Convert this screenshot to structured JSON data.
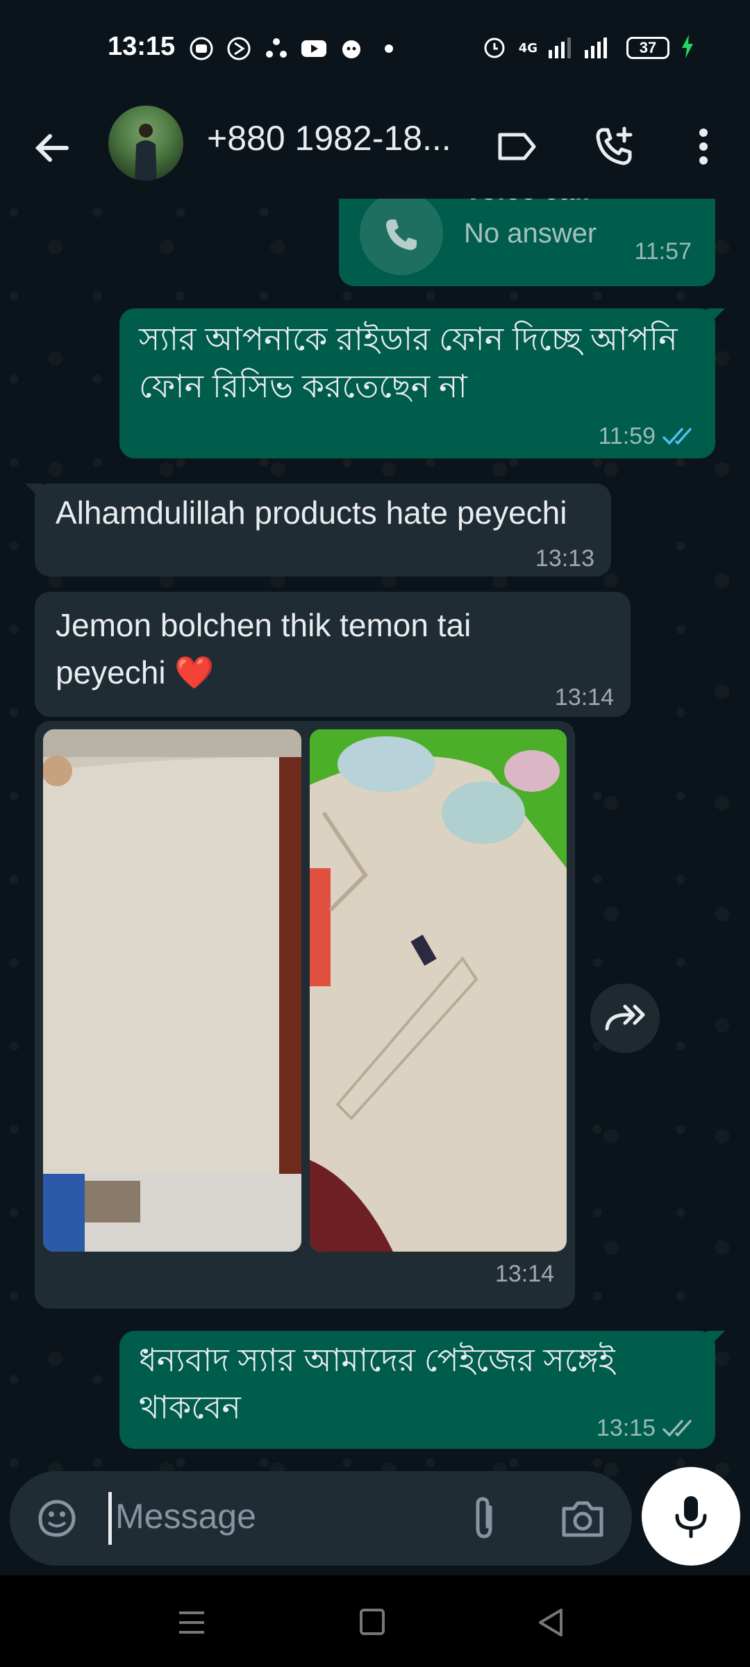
{
  "status_bar": {
    "time": "13:15",
    "network": "4G",
    "battery": "37",
    "icons": [
      "youtube-icon",
      "app-icon",
      "share-icon",
      "youtube-icon",
      "app-icon",
      "dot-icon",
      "alarm-icon",
      "signal-icon",
      "charging-icon"
    ]
  },
  "header": {
    "contact_name": "+880 1982-18...",
    "icons": [
      "back-arrow-icon",
      "label-icon",
      "add-call-icon",
      "more-vert-icon"
    ]
  },
  "messages": [
    {
      "direction": "outgoing",
      "type": "call",
      "call_title": "Voice call",
      "call_status": "No answer",
      "time": "11:57"
    },
    {
      "direction": "outgoing",
      "type": "text",
      "text": "স্যার আপনাকে রাইডার ফোন দিচ্ছে আপনি ফোন রিসিভ করতেছেন না",
      "time": "11:59",
      "read": true
    },
    {
      "direction": "incoming",
      "type": "text",
      "text": "Alhamdulillah products hate peyechi",
      "time": "13:13"
    },
    {
      "direction": "incoming",
      "type": "text",
      "text": "Jemon bolchen thik temon tai peyechi ❤️",
      "time": "13:14"
    },
    {
      "direction": "incoming",
      "type": "images",
      "count": 2,
      "time": "13:14"
    },
    {
      "direction": "outgoing",
      "type": "text",
      "text": "ধন্যবাদ স্যার আমাদের পেইজের সঙ্গেই থাকবেন",
      "time": "13:15",
      "read": false
    }
  ],
  "composer": {
    "placeholder": "Message"
  },
  "colors": {
    "background": "#0b141a",
    "outgoing_bubble": "#005c4b",
    "incoming_bubble": "#202c33",
    "read_tick": "#53bdeb"
  }
}
